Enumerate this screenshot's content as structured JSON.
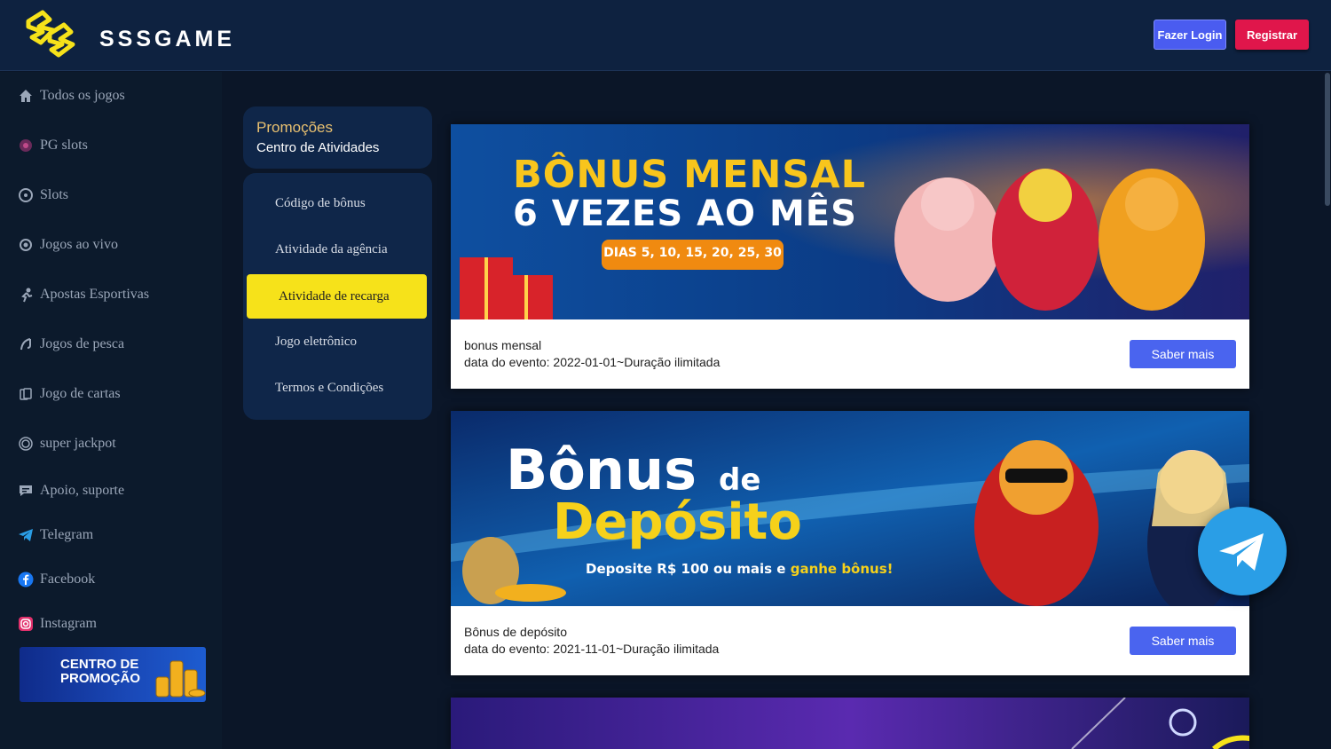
{
  "header": {
    "logo_text": "SSSGAME",
    "login_label": "Fazer Login",
    "register_label": "Registrar"
  },
  "sidebar": {
    "items": [
      {
        "label": "Todos os jogos",
        "icon": "home-icon"
      },
      {
        "label": "PG slots",
        "icon": "pg-icon"
      },
      {
        "label": "Slots",
        "icon": "slots-icon"
      },
      {
        "label": "Jogos ao vivo",
        "icon": "live-icon"
      },
      {
        "label": "Apostas Esportivas",
        "icon": "sports-icon"
      },
      {
        "label": "Jogos de pesca",
        "icon": "fish-icon"
      },
      {
        "label": "Jogo de cartas",
        "icon": "cards-icon"
      },
      {
        "label": "super jackpot",
        "icon": "jackpot-icon"
      },
      {
        "label": "Apoio, suporte",
        "icon": "support-icon"
      },
      {
        "label": "Telegram",
        "icon": "telegram-icon"
      },
      {
        "label": "Facebook",
        "icon": "facebook-icon"
      },
      {
        "label": "Instagram",
        "icon": "instagram-icon"
      }
    ],
    "promo_banner": {
      "line1": "CENTRO DE",
      "line2": "PROMOÇÃO"
    }
  },
  "promo_menu": {
    "head_title": "Promoções",
    "head_subtitle": "Centro de Atividades",
    "items": [
      {
        "label": "Código de bônus",
        "active": false
      },
      {
        "label": "Atividade da agência",
        "active": false
      },
      {
        "label": "Atividade de recarga",
        "active": true
      },
      {
        "label": "Jogo eletrônico",
        "active": false
      },
      {
        "label": "Termos e Condições",
        "active": false
      }
    ]
  },
  "cards": [
    {
      "banner_line1": "BÔNUS MENSAL",
      "banner_line2": "6 VEZES AO MÊS",
      "banner_badge": "DIAS 5, 10, 15, 20, 25, 30",
      "title": "bonus mensal",
      "date": "data do evento:  2022-01-01~Duração ilimitada",
      "button": "Saber mais"
    },
    {
      "banner_line1": "Bônus",
      "banner_de": "de",
      "banner_line2": "Depósito",
      "banner_sub_a": "Deposite R$ 100 ou mais e",
      "banner_sub_b": "ganhe bônus!",
      "title": "Bônus de depósito",
      "date": "data do evento:  2021-11-01~Duração ilimitada",
      "button": "Saber mais"
    }
  ],
  "colors": {
    "accent_yellow": "#f6e21a",
    "login_blue": "#4a5cf0",
    "register_red": "#e0164b",
    "button_blue": "#4a64ef"
  }
}
